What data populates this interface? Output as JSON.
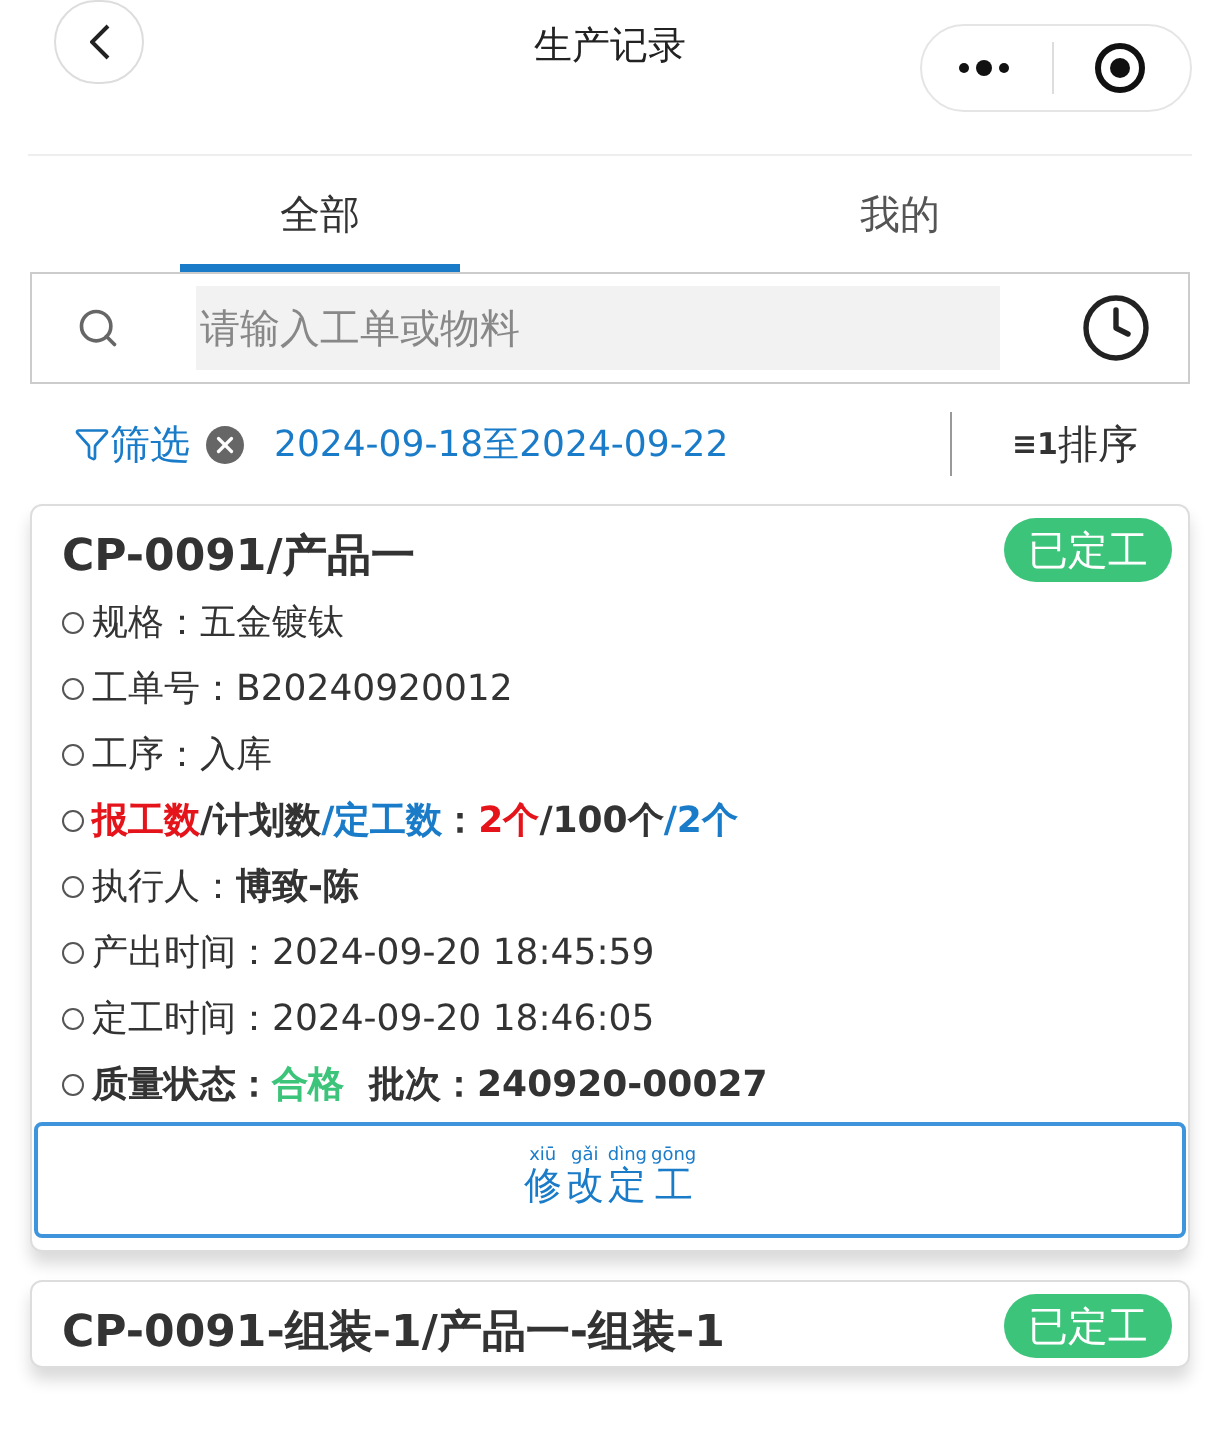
{
  "header": {
    "title": "生产记录"
  },
  "tabs": [
    {
      "label": "全部",
      "selected": true
    },
    {
      "label": "我的",
      "selected": false
    }
  ],
  "search": {
    "placeholder": "请输入工单或物料"
  },
  "filter": {
    "label": "筛选",
    "date_range": "2024-09-18至2024-09-22",
    "sort_badge": "≡1",
    "sort_label": "排序"
  },
  "records": [
    {
      "title": "CP-0091/产品一",
      "status": "已定工",
      "rows": [
        [
          {
            "text": "规格：",
            "kind": "normal"
          },
          {
            "text": "五金镀钛",
            "kind": "normal"
          }
        ],
        [
          {
            "text": "工单号：",
            "kind": "normal"
          },
          {
            "text": "B20240920012",
            "kind": "normal"
          }
        ],
        [
          {
            "text": "工序：",
            "kind": "normal"
          },
          {
            "text": "入库",
            "kind": "normal"
          }
        ],
        [
          {
            "text": "报工数",
            "kind": "red"
          },
          {
            "text": "/计划数",
            "kind": "bold"
          },
          {
            "text": "/定工数",
            "kind": "blue"
          },
          {
            "text": "：",
            "kind": "bold"
          },
          {
            "text": "2个",
            "kind": "red"
          },
          {
            "text": "/100个",
            "kind": "bold"
          },
          {
            "text": "/2个",
            "kind": "blue"
          }
        ],
        [
          {
            "text": "执行人：",
            "kind": "normal"
          },
          {
            "text": "博致-陈",
            "kind": "bold"
          }
        ],
        [
          {
            "text": "产出时间：",
            "kind": "normal"
          },
          {
            "text": "2024-09-20 18:45:59",
            "kind": "normal"
          }
        ],
        [
          {
            "text": "定工时间：",
            "kind": "normal"
          },
          {
            "text": "2024-09-20 18:46:05",
            "kind": "normal"
          }
        ],
        [
          {
            "text": "质量状态：",
            "kind": "bold"
          },
          {
            "text": "合格",
            "kind": "green"
          },
          {
            "text": "  批次：240920-00027",
            "kind": "bold"
          }
        ]
      ],
      "action": {
        "chars": [
          {
            "han": "修",
            "pinyin": "xiū"
          },
          {
            "han": "改",
            "pinyin": "gǎi"
          },
          {
            "han": "定",
            "pinyin": "dìng"
          },
          {
            "han": "工",
            "pinyin": "gōng"
          }
        ]
      }
    },
    {
      "title": "CP-0091-组装-1/产品一-组装-1",
      "status": "已定工"
    }
  ]
}
